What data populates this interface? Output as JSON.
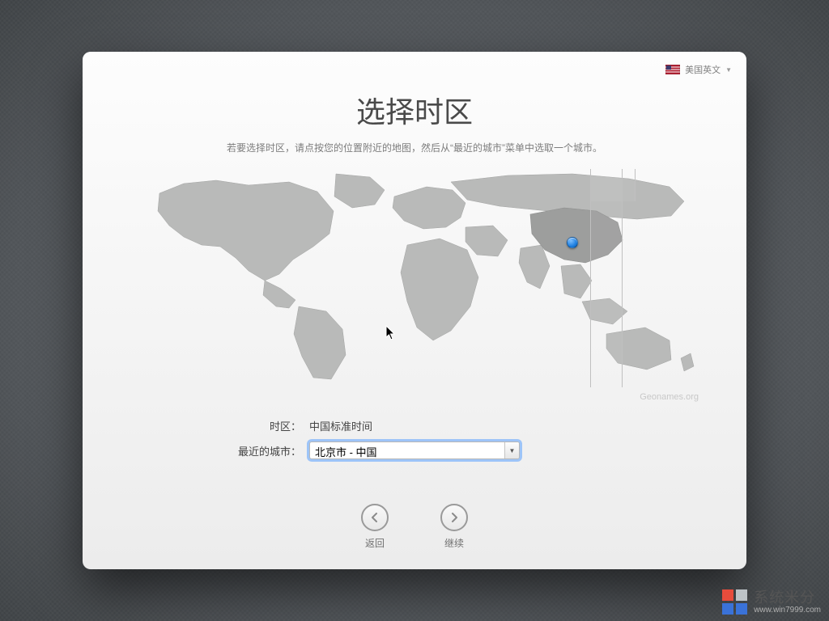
{
  "language_picker": {
    "label": "美国英文",
    "flag": "us"
  },
  "title": "选择时区",
  "subtitle": "若要选择时区，请点按您的位置附近的地图，然后从“最近的城市”菜单中选取一个城市。",
  "timezone_label": "时区：",
  "timezone_value": "中国标准时间",
  "city_label": "最近的城市：",
  "city_value": "北京市 - 中国",
  "attribution": "Geonames.org",
  "nav": {
    "back": "返回",
    "continue": "继续"
  },
  "watermark": {
    "brand": "系统米分",
    "url": "www.win7999.com"
  }
}
